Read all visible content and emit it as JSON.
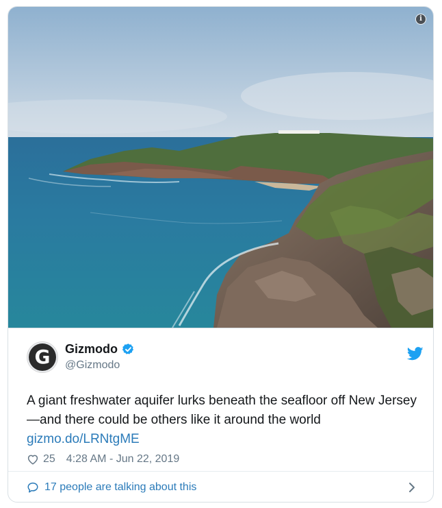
{
  "tweet": {
    "display_name": "Gizmodo",
    "handle": "@Gizmodo",
    "avatar_letter": "G",
    "text": "A giant freshwater aquifer lurks beneath the seafloor off New Jersey—and there could be others like it around the world",
    "link": "gizmo.do/LRNtgME",
    "likes": "25",
    "timestamp": "4:28 AM - Jun 22, 2019",
    "talking": "17 people are talking about this",
    "info_glyph": "i"
  },
  "icons": {
    "info": "info-icon",
    "verified": "verified-badge-icon",
    "twitter": "twitter-bird-icon",
    "like": "heart-icon",
    "reply": "speech-bubble-icon",
    "chevron": "chevron-right-icon"
  },
  "colors": {
    "link": "#2b7bb9",
    "twitter_blue": "#1da1f2",
    "secondary_text": "#657786",
    "border": "#d8dfe4"
  }
}
